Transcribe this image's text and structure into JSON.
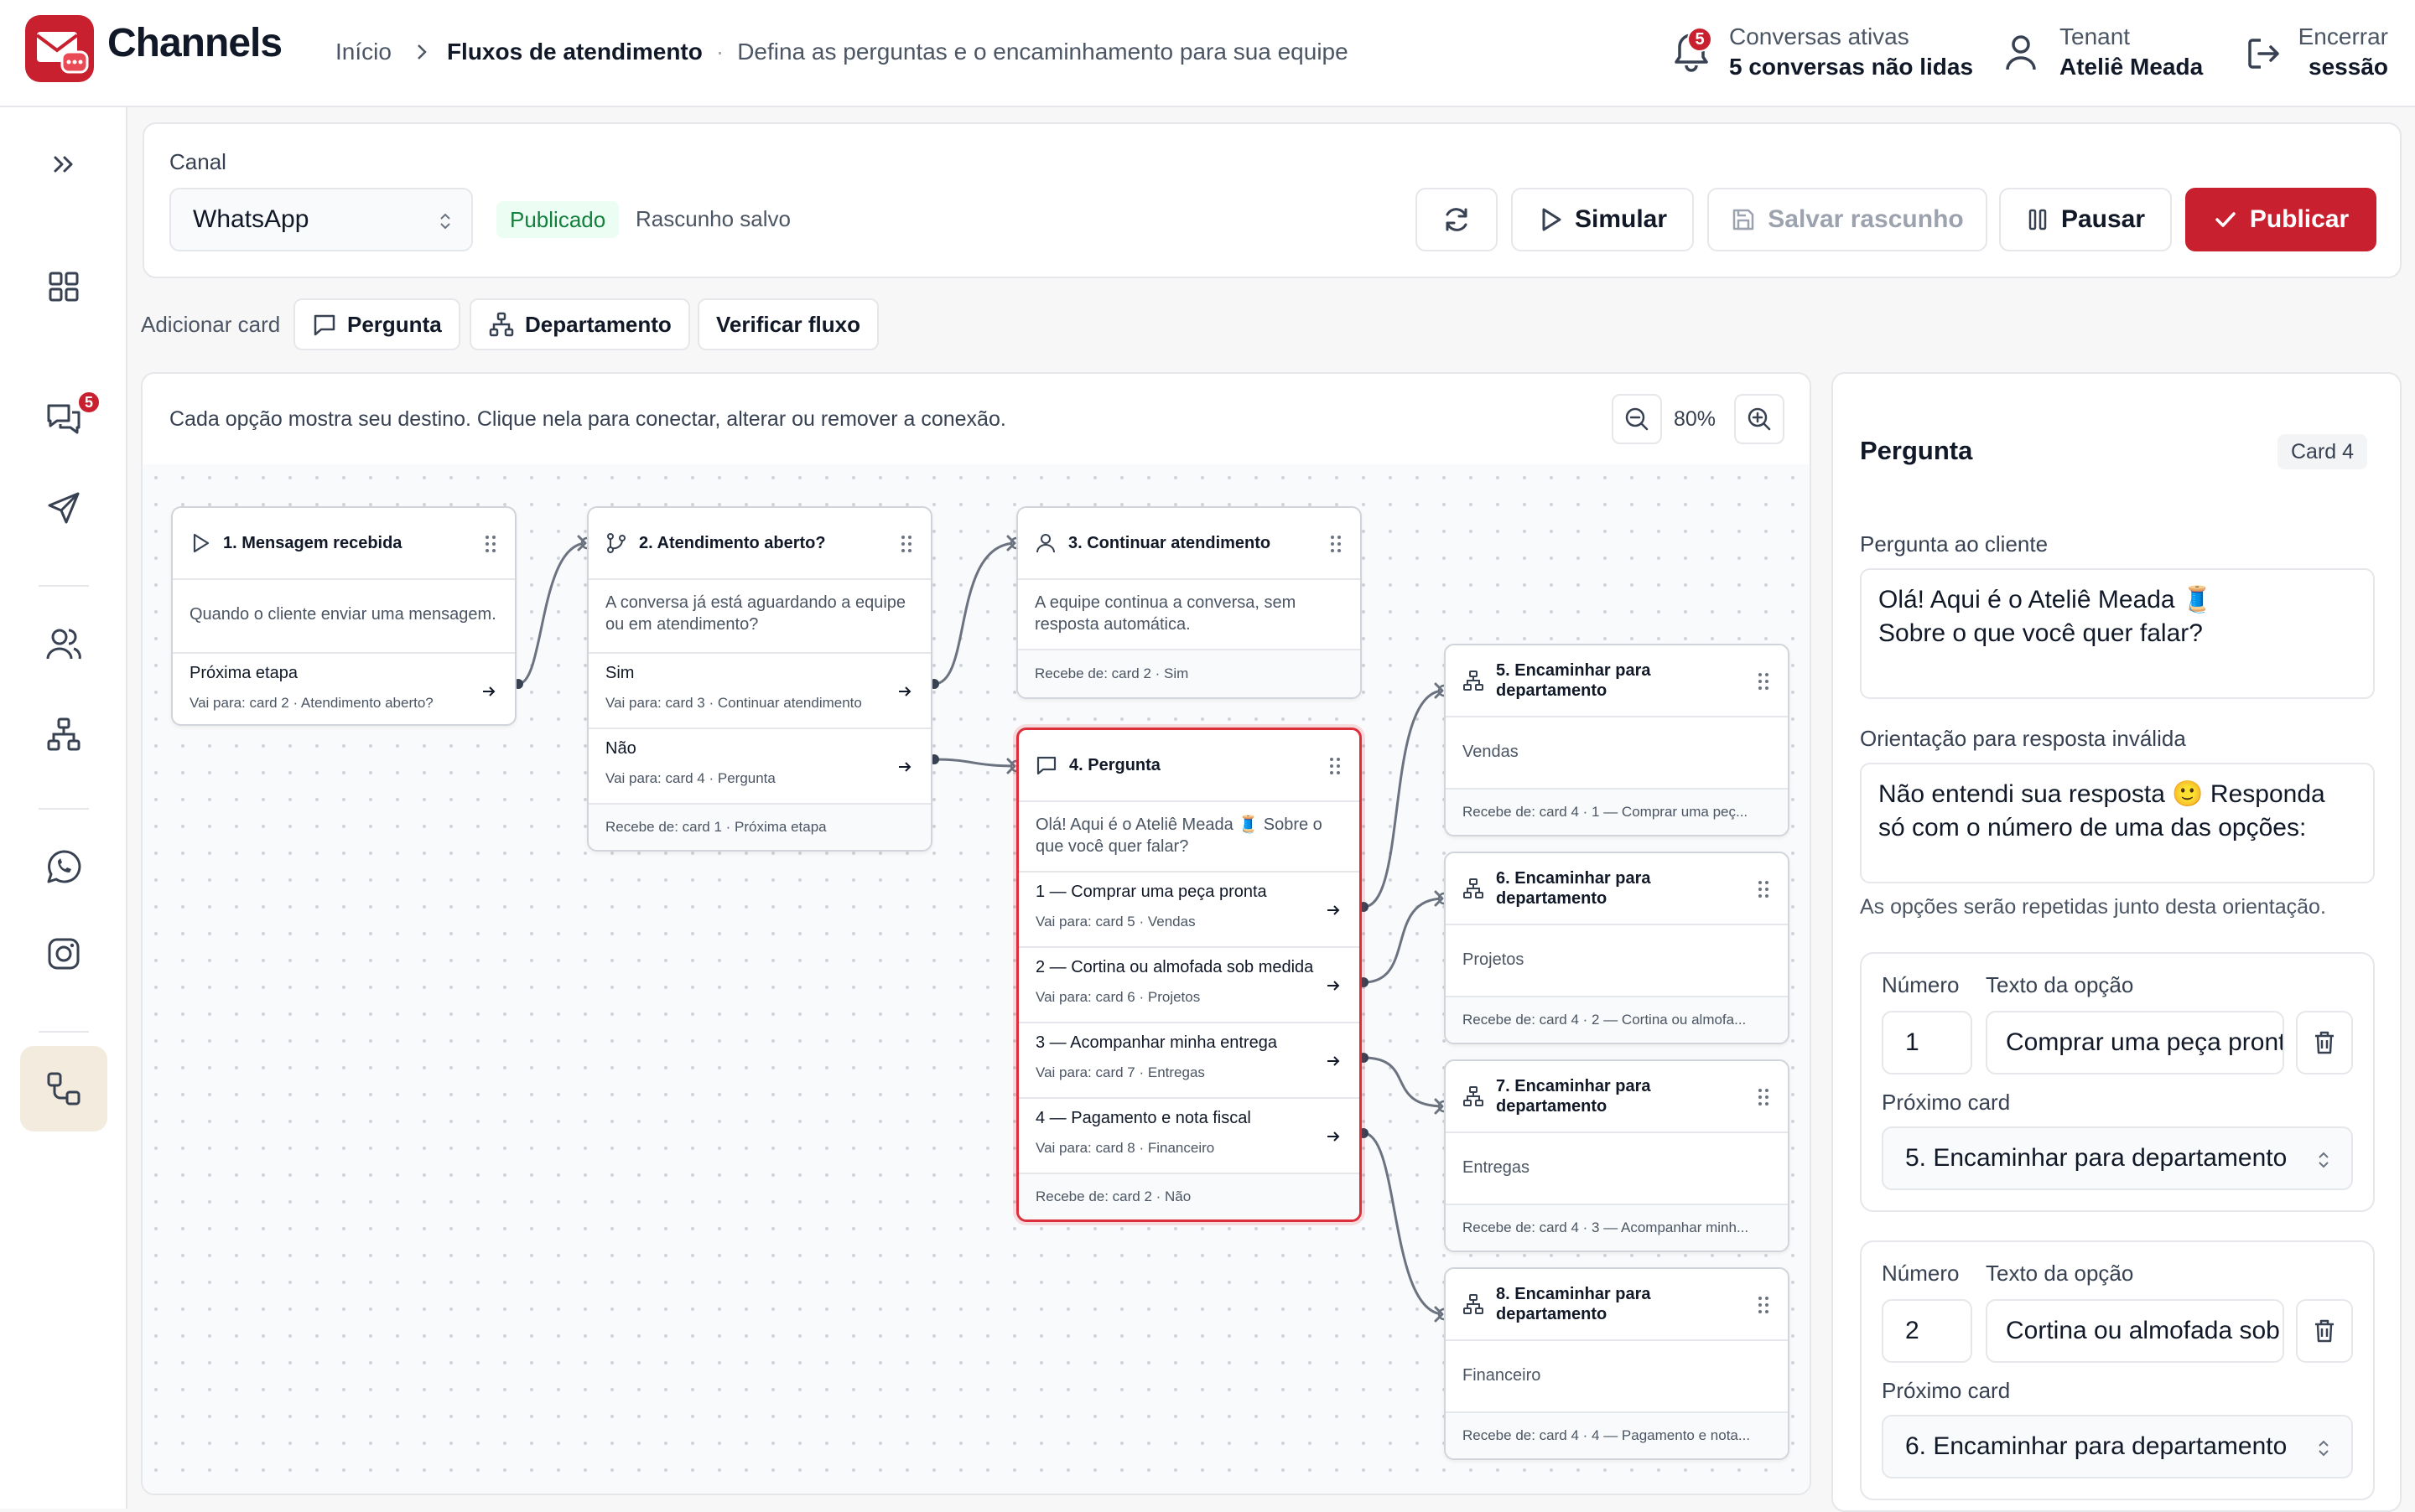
{
  "header": {
    "brand": "Channels",
    "breadcrumb_home": "Início",
    "breadcrumb_current": "Fluxos de atendimento",
    "breadcrumb_desc": "Defina as perguntas e o encaminhamento para sua equipe",
    "notif_badge": "5",
    "notif_title": "Conversas ativas",
    "notif_sub": "5 conversas não lidas",
    "tenant_label": "Tenant",
    "tenant_name": "Ateliê Meada",
    "logout_l1": "Encerrar",
    "logout_l2": "sessão"
  },
  "sidebar": {
    "chat_badge": "5"
  },
  "toolbar": {
    "channel_label": "Canal",
    "channel_value": "WhatsApp",
    "status_badge": "Publicado",
    "draft_status": "Rascunho salvo",
    "simulate": "Simular",
    "save_draft": "Salvar rascunho",
    "pause": "Pausar",
    "publish": "Publicar"
  },
  "add_bar": {
    "label": "Adicionar card",
    "question": "Pergunta",
    "department": "Departamento",
    "verify": "Verificar fluxo"
  },
  "canvas": {
    "hint": "Cada opção mostra seu destino. Clique nela para conectar, alterar ou remover a conexão.",
    "zoom": "80%"
  },
  "cards": [
    {
      "title": "1. Mensagem recebida",
      "body": "Quando o cliente enviar uma mensagem.",
      "options": [
        {
          "label": "Próxima etapa",
          "dest": "Vai para: card 2 · Atendimento aberto?"
        }
      ],
      "foot": ""
    },
    {
      "title": "2. Atendimento aberto?",
      "body": "A conversa já está aguardando a equipe ou em atendimento?",
      "options": [
        {
          "label": "Sim",
          "dest": "Vai para: card 3 · Continuar atendimento"
        },
        {
          "label": "Não",
          "dest": "Vai para: card 4 · Pergunta"
        }
      ],
      "foot": "Recebe de: card 1 · Próxima etapa"
    },
    {
      "title": "3. Continuar atendimento",
      "body": "A equipe continua a conversa, sem resposta automática.",
      "options": [],
      "foot": "Recebe de: card 2 · Sim"
    },
    {
      "title": "4. Pergunta",
      "body": "Olá! Aqui é o Ateliê Meada 🧵 Sobre o que você quer falar?",
      "options": [
        {
          "label": "1 — Comprar uma peça pronta",
          "dest": "Vai para: card 5 · Vendas"
        },
        {
          "label": "2 — Cortina ou almofada sob medida",
          "dest": "Vai para: card 6 · Projetos"
        },
        {
          "label": "3 — Acompanhar minha entrega",
          "dest": "Vai para: card 7 · Entregas"
        },
        {
          "label": "4 — Pagamento e nota fiscal",
          "dest": "Vai para: card 8 · Financeiro"
        }
      ],
      "foot": "Recebe de: card 2 · Não"
    },
    {
      "title": "5. Encaminhar para departamento",
      "body": "Vendas",
      "options": [],
      "foot": "Recebe de: card 4 · 1 — Comprar uma peç..."
    },
    {
      "title": "6. Encaminhar para departamento",
      "body": "Projetos",
      "options": [],
      "foot": "Recebe de: card 4 · 2 — Cortina ou almofa..."
    },
    {
      "title": "7. Encaminhar para departamento",
      "body": "Entregas",
      "options": [],
      "foot": "Recebe de: card 4 · 3 — Acompanhar minh..."
    },
    {
      "title": "8. Encaminhar para departamento",
      "body": "Financeiro",
      "options": [],
      "foot": "Recebe de: card 4 · 4 — Pagamento e nota..."
    }
  ],
  "inspector": {
    "title": "Pergunta",
    "card_badge": "Card 4",
    "question_label": "Pergunta ao cliente",
    "question_line1": "Olá! Aqui é o Ateliê Meada 🧵",
    "question_line2": "Sobre o que você quer falar?",
    "invalid_label": "Orientação para resposta inválida",
    "invalid_text": "Não entendi sua resposta 🙂  Responda só com o número de uma das opções:",
    "invalid_help": "As opções serão repetidas junto desta orientação.",
    "number_label": "Número",
    "option_text_label": "Texto da opção",
    "next_label": "Próximo card",
    "options": [
      {
        "number": "1",
        "text": "Comprar uma peça pronta",
        "next": "5. Encaminhar para departamento"
      },
      {
        "number": "2",
        "text": "Cortina ou almofada sob medida",
        "next": "6. Encaminhar para departamento"
      }
    ]
  },
  "colors": {
    "brand": "#c8202f",
    "published_bg": "#ecfdf3",
    "published_text": "#15803d",
    "selected_border": "#dc2f3b"
  }
}
